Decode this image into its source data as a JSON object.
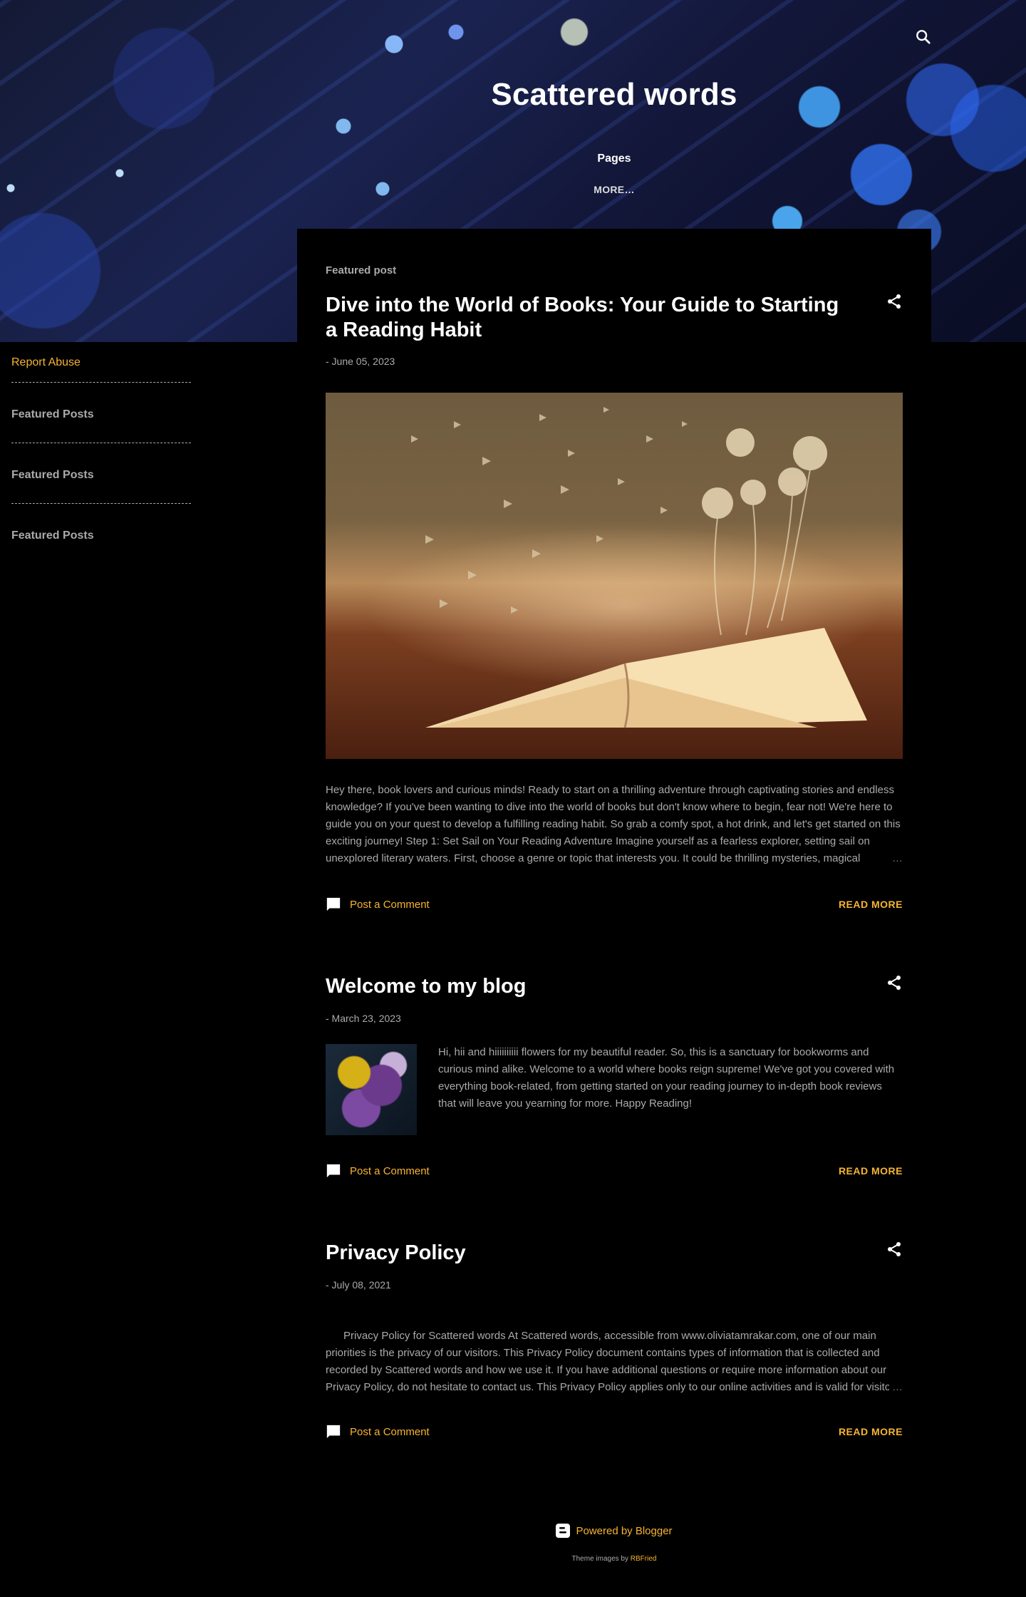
{
  "header": {
    "site_title": "Scattered words",
    "pages_label": "Pages",
    "more_label": "MORE…"
  },
  "sidebar": {
    "report_abuse": "Report Abuse",
    "sections": [
      "Featured Posts",
      "Featured Posts",
      "Featured Posts"
    ]
  },
  "posts": [
    {
      "label": "Featured post",
      "title": "Dive into the World of Books: Your Guide to Starting a Reading Habit",
      "date": "- June 05, 2023",
      "body": "Hey there, book lovers and curious minds! Ready to start on a thrilling adventure through captivating stories and endless knowledge? If you've been wanting to dive into the world of books but don't know where to begin, fear not! We're here to guide you on your quest to develop a fulfilling reading habit. So grab a comfy spot, a hot drink, and let's get started on this exciting journey! Step 1: Set Sail on Your Reading Adventure Imagine yourself as a fearless explorer, setting sail on unexplored literary waters. First, choose a genre or topic that interests you. It could be thrilling mysteries, magical",
      "comment_label": "Post a Comment",
      "read_more": "READ MORE"
    },
    {
      "title": "Welcome to my blog",
      "date": "- March 23, 2023",
      "body": "Hi, hii and hiiiiiiiiii flowers for my beautiful reader. So, this is a sanctuary for bookworms and curious mind alike. Welcome to a world where books reign supreme! We've got you covered with everything book-related, from getting started on your reading journey to in-depth book reviews that will leave you yearning for more. Happy Reading!",
      "comment_label": "Post a Comment",
      "read_more": "READ MORE"
    },
    {
      "title": "Privacy Policy",
      "date": "- July 08, 2021",
      "body": "  Privacy Policy for Scattered words At Scattered words, accessible from www.oliviatamrakar.com, one of our main priorities is the privacy of our visitors. This Privacy Policy document contains types of information that is collected and recorded by Scattered words and how we use it. If you have additional questions or require more information about our Privacy Policy, do not hesitate to contact us. This Privacy Policy applies only to our online activities and is valid for visitors to our website with regards to the information that they shared and/or collect in Scattered words. This policy is",
      "comment_label": "Post a Comment",
      "read_more": "READ MORE"
    }
  ],
  "ellipsis": "…",
  "footer": {
    "powered_by": "Powered by Blogger",
    "theme_prefix": "Theme images by ",
    "theme_author": "RBFried"
  },
  "colors": {
    "accent": "#f6b431",
    "background": "#000000",
    "text": "#aaaaaa",
    "title": "#ffffff"
  },
  "icons": [
    "search-icon",
    "share-icon",
    "comment-icon",
    "blogger-icon"
  ]
}
